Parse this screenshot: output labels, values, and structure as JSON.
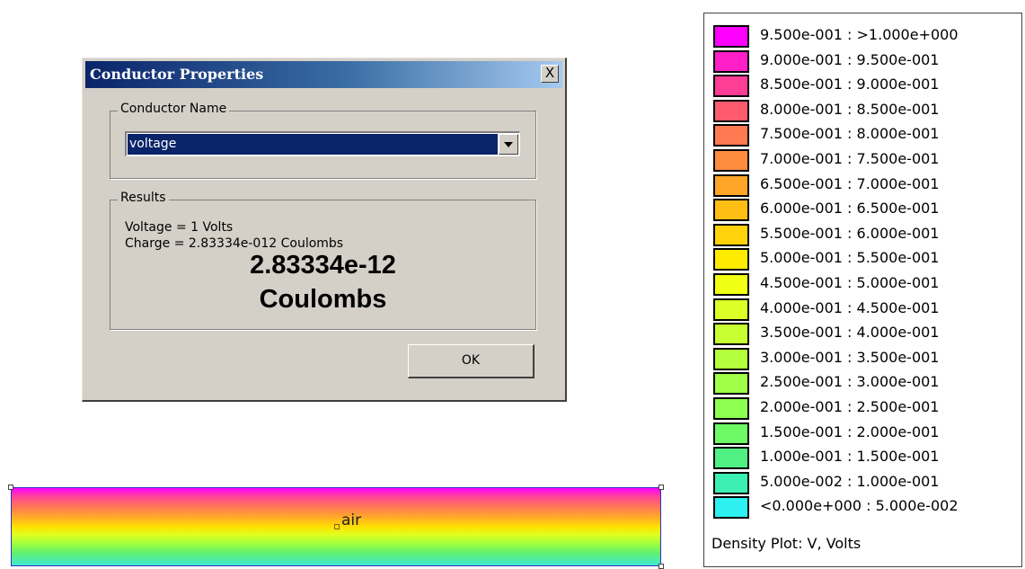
{
  "dialog": {
    "title": "Conductor Properties",
    "close_label": "X",
    "conductor_group_label": "Conductor Name",
    "conductor_selected": "voltage",
    "results_group_label": "Results",
    "voltage_line": "Voltage = 1 Volts",
    "charge_line": "Charge = 2.83334e-012 Coulombs",
    "charge_big_value": "2.83334e-12",
    "charge_big_unit": "Coulombs",
    "ok_label": "OK"
  },
  "plot": {
    "region_label": "air"
  },
  "legend": {
    "caption": "Density Plot: V, Volts",
    "items": [
      {
        "label": "9.500e-001 : >1.000e+000",
        "color": "#ff00ff"
      },
      {
        "label": "9.000e-001 : 9.500e-001",
        "color": "#ff1ec8"
      },
      {
        "label": "8.500e-001 : 9.000e-001",
        "color": "#ff3c96"
      },
      {
        "label": "8.000e-001 : 8.500e-001",
        "color": "#ff5a6e"
      },
      {
        "label": "7.500e-001 : 8.000e-001",
        "color": "#ff7a50"
      },
      {
        "label": "7.000e-001 : 7.500e-001",
        "color": "#ff8c3c"
      },
      {
        "label": "6.500e-001 : 7.000e-001",
        "color": "#ffa528"
      },
      {
        "label": "6.000e-001 : 6.500e-001",
        "color": "#ffbe14"
      },
      {
        "label": "5.500e-001 : 6.000e-001",
        "color": "#ffd20a"
      },
      {
        "label": "5.000e-001 : 5.500e-001",
        "color": "#ffeb00"
      },
      {
        "label": "4.500e-001 : 5.000e-001",
        "color": "#f0ff14"
      },
      {
        "label": "4.000e-001 : 4.500e-001",
        "color": "#dcff28"
      },
      {
        "label": "3.500e-001 : 4.000e-001",
        "color": "#c8ff32"
      },
      {
        "label": "3.000e-001 : 3.500e-001",
        "color": "#b4ff3c"
      },
      {
        "label": "2.500e-001 : 3.000e-001",
        "color": "#a0ff46"
      },
      {
        "label": "2.000e-001 : 2.500e-001",
        "color": "#8cff50"
      },
      {
        "label": "1.500e-001 : 2.000e-001",
        "color": "#6efa64"
      },
      {
        "label": "1.000e-001 : 1.500e-001",
        "color": "#50f082"
      },
      {
        "label": "5.000e-002 : 1.000e-001",
        "color": "#3cf0b4"
      },
      {
        "label": "<0.000e+000 : 5.000e-002",
        "color": "#2df0f0"
      }
    ]
  }
}
